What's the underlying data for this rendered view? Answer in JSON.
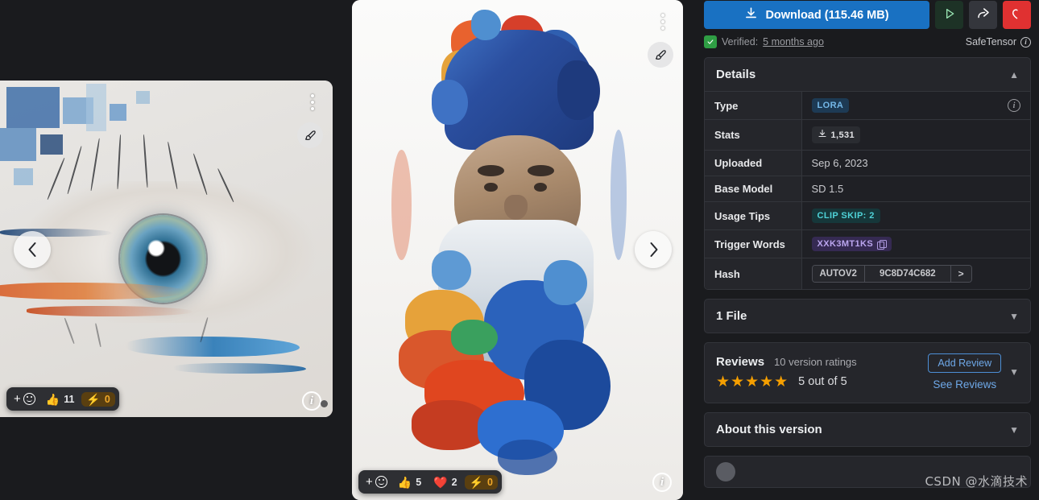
{
  "sidebar": {
    "download_label": "Download (115.46 MB)",
    "download_icon": "download-icon",
    "run_icon": "play-icon",
    "share_icon": "share-icon",
    "favorite_icon": "heart-icon",
    "verified_prefix": "Verified:",
    "verified_time": "5 months ago",
    "safetensor_label": "SafeTensor",
    "details": {
      "title": "Details",
      "rows": [
        {
          "key": "Type",
          "value": "LORA",
          "kind": "badge-lora",
          "info": true
        },
        {
          "key": "Stats",
          "value": "1,531",
          "kind": "badge-stats",
          "icon": "download-icon"
        },
        {
          "key": "Uploaded",
          "value": "Sep 6, 2023",
          "kind": "text"
        },
        {
          "key": "Base Model",
          "value": "SD 1.5",
          "kind": "text"
        },
        {
          "key": "Usage Tips",
          "value": "CLIP SKIP: 2",
          "kind": "badge-clip"
        },
        {
          "key": "Trigger Words",
          "value": "XXK3MT1KS",
          "kind": "badge-trigger",
          "copy": true
        },
        {
          "key": "Hash",
          "value": "9C8D74C682",
          "kind": "hash",
          "algo": "AUTOV2",
          "expand": ">"
        }
      ]
    },
    "files": {
      "title": "1 File"
    },
    "reviews": {
      "title": "Reviews",
      "ratings_count": "10 version ratings",
      "stars": "★★★★★",
      "score": "5 out of 5",
      "add_review": "Add Review",
      "see_reviews": "See Reviews"
    },
    "about": {
      "title": "About this version"
    }
  },
  "gallery": {
    "prev_icon": "chevron-left-icon",
    "next_icon": "chevron-right-icon",
    "menu_icon": "dots-vertical-icon",
    "brush_icon": "paintbrush-icon",
    "info_icon": "info-icon",
    "left_image": {
      "alt": "abstract blue eye artwork",
      "reactions": {
        "add_label": "+",
        "items": [
          {
            "icon": "thumbs-up-icon",
            "glyph": "👍",
            "count": "11",
            "active": false
          },
          {
            "icon": "lightning-icon",
            "glyph": "⚡",
            "count": "0",
            "active": true
          }
        ]
      }
    },
    "right_image": {
      "alt": "watercolor wizard portrait",
      "reactions": {
        "add_label": "+",
        "items": [
          {
            "icon": "thumbs-up-icon",
            "glyph": "👍",
            "count": "5",
            "active": false
          },
          {
            "icon": "heart-icon",
            "glyph": "❤️",
            "count": "2",
            "active": false
          },
          {
            "icon": "lightning-icon",
            "glyph": "⚡",
            "count": "0",
            "active": true
          }
        ]
      }
    }
  },
  "watermark": "CSDN @水滴技术",
  "colors": {
    "accent_blue": "#1971c2",
    "favorite_red": "#e03131",
    "verified_green": "#2f9e44",
    "star_orange": "#f59f00",
    "bolt_amber": "#f0a92a",
    "page_bg": "#1a1b1e",
    "panel_bg": "#25262b"
  }
}
